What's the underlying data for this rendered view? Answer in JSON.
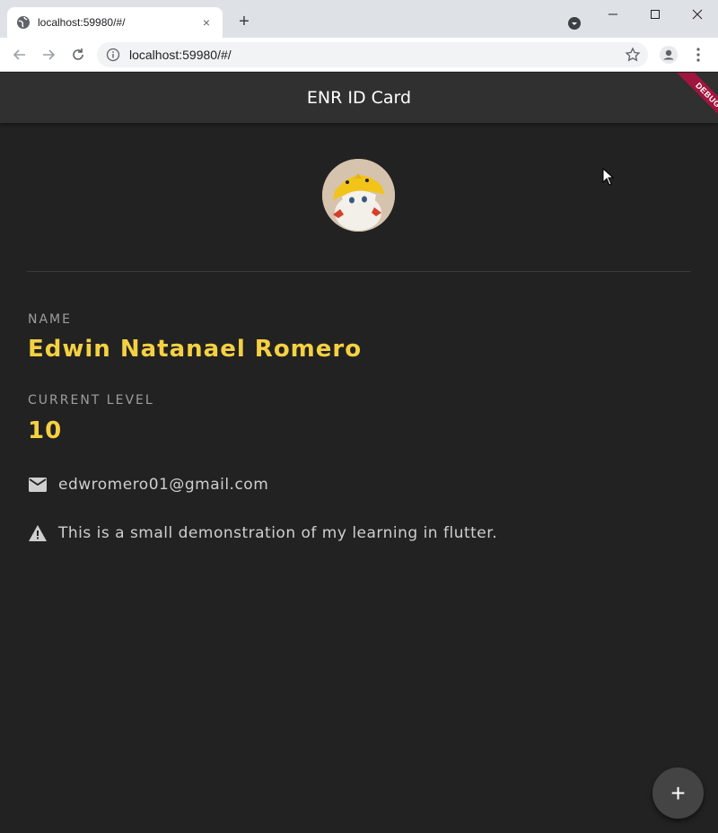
{
  "browser": {
    "tab_title": "localhost:59980/#/",
    "tab_close": "×",
    "new_tab": "+",
    "url": "localhost:59980/#/"
  },
  "app": {
    "title": "ENR ID Card",
    "debug_banner": "DEBUG",
    "name_label": "NAME",
    "name_value": "Edwin Natanael Romero",
    "level_label": "CURRENT LEVEL",
    "level_value": "10",
    "email": "edwromero01@gmail.com",
    "note": "This is a small demonstration of my learning in flutter.",
    "fab": "+"
  },
  "colors": {
    "accent": "#f5d142",
    "background": "#222222",
    "appbar": "#303030",
    "debug": "#a0153e"
  }
}
